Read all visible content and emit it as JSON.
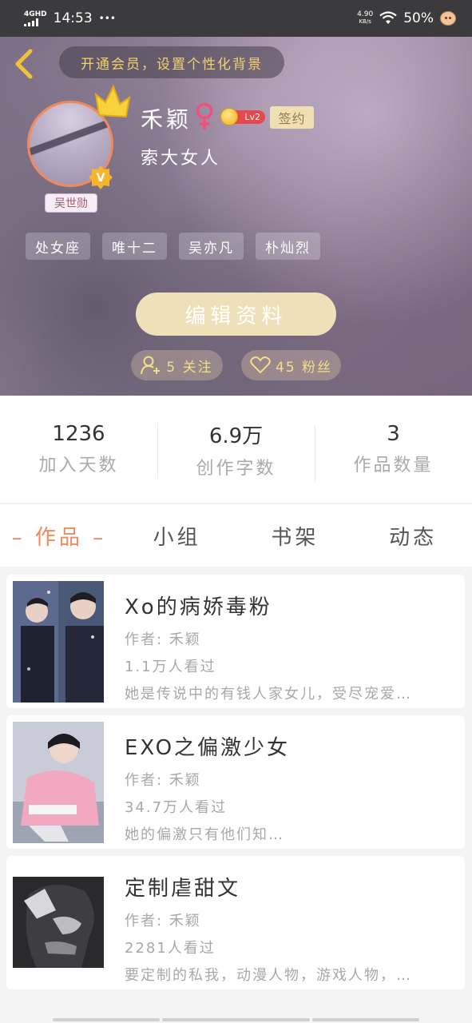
{
  "status_bar": {
    "network": "4GHD",
    "time": "14:53",
    "more": "•••",
    "speed_value": "4.90",
    "speed_unit": "KB/s",
    "battery": "50%"
  },
  "header": {
    "vip_prompt": "开通会员，设置个性化背景",
    "avatar_name": "吴世勋",
    "username": "禾颖",
    "level": "Lv2",
    "sign_label": "签约",
    "signature": "索大女人",
    "tags": [
      "处女座",
      "唯十二",
      "吴亦凡",
      "朴灿烈"
    ],
    "edit_button": "编辑资料",
    "following": "5 关注",
    "fans": "45 粉丝"
  },
  "stats": [
    {
      "value": "1236",
      "label": "加入天数"
    },
    {
      "value": "6.9万",
      "label": "创作字数"
    },
    {
      "value": "3",
      "label": "作品数量"
    }
  ],
  "tabs": [
    "作品",
    "小组",
    "书架",
    "动态"
  ],
  "active_tab": "作品",
  "works": [
    {
      "title": "Xo的病娇毒粉",
      "author": "作者: 禾颖",
      "views": "1.1万人看过",
      "desc": "她是传说中的有钱人家女儿，受尽宠爱…"
    },
    {
      "title": "EXO之偏激少女",
      "author": "作者: 禾颖",
      "views": "34.7万人看过",
      "desc": "她的偏激只有他们知…"
    },
    {
      "title": "定制虐甜文",
      "author": "作者: 禾颖",
      "views": "2281人看过",
      "desc": "要定制的私我，动漫人物，游戏人物，…"
    }
  ],
  "colors": {
    "accent": "#f08a5d",
    "vip_text": "#f0d36e",
    "edit_button_bg": "#eee0b9",
    "level_badge": "#e5484d"
  }
}
